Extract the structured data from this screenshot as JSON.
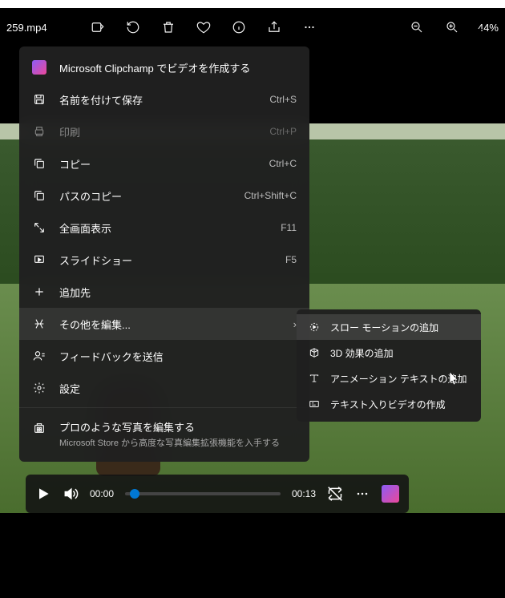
{
  "filename": "259.mp4",
  "zoom": "44%",
  "player": {
    "current_time": "00:00",
    "duration": "00:13"
  },
  "menu": {
    "clipchamp": "Microsoft Clipchamp でビデオを作成する",
    "save_as": {
      "label": "名前を付けて保存",
      "shortcut": "Ctrl+S"
    },
    "print": {
      "label": "印刷",
      "shortcut": "Ctrl+P"
    },
    "copy": {
      "label": "コピー",
      "shortcut": "Ctrl+C"
    },
    "copy_path": {
      "label": "パスのコピー",
      "shortcut": "Ctrl+Shift+C"
    },
    "fullscreen": {
      "label": "全画面表示",
      "shortcut": "F11"
    },
    "slideshow": {
      "label": "スライドショー",
      "shortcut": "F5"
    },
    "add_to": "追加先",
    "edit_more": "その他を編集...",
    "feedback": "フィードバックを送信",
    "settings": "設定",
    "pro_title": "プロのような写真を編集する",
    "pro_sub": "Microsoft Store から高度な写真編集拡張機能を入手する"
  },
  "submenu": {
    "slow_motion": "スロー モーションの追加",
    "3d_effects": "3D 効果の追加",
    "animated_text": "アニメーション テキストの追加",
    "create_video": "テキスト入りビデオの作成"
  }
}
